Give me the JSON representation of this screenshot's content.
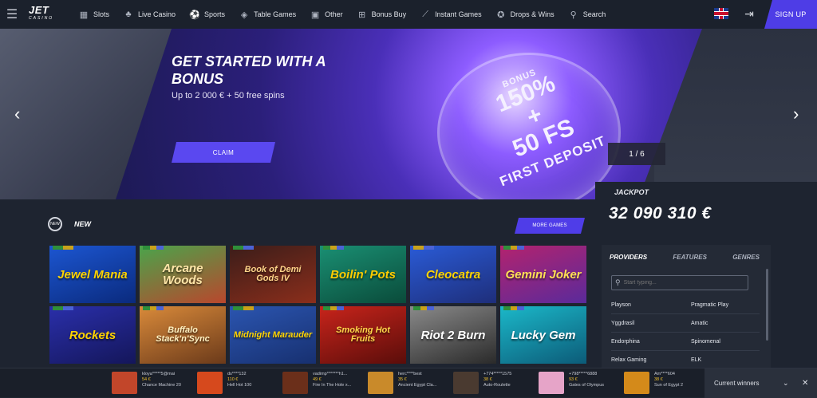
{
  "topbar": {
    "menu_icon": "hamburger-icon",
    "logo_main": "JET",
    "logo_sub": "CASINO",
    "nav": [
      {
        "label": "Slots",
        "icon": "slots-icon"
      },
      {
        "label": "Live Casino",
        "icon": "live-casino-icon"
      },
      {
        "label": "Sports",
        "icon": "sports-icon"
      },
      {
        "label": "Table Games",
        "icon": "table-games-icon"
      },
      {
        "label": "Other",
        "icon": "other-icon"
      },
      {
        "label": "Bonus Buy",
        "icon": "bonus-buy-icon"
      },
      {
        "label": "Instant Games",
        "icon": "instant-games-icon"
      },
      {
        "label": "Drops & Wins",
        "icon": "drops-wins-icon"
      },
      {
        "label": "Search",
        "icon": "search-icon"
      }
    ],
    "signup_label": "SIGN UP"
  },
  "hero": {
    "title": "GET STARTED WITH A BONUS",
    "subtitle": "Up to 2 000 € + 50 free spins",
    "claim_label": "CLAIM",
    "badge_small": "BONUS",
    "badge_line1": "150%",
    "badge_line2": "+",
    "badge_line3": "50 FS",
    "badge_deposit": "FIRST DEPOSIT",
    "slide_counter": "1 / 6",
    "prev_arrow": "‹",
    "next_arrow": "›"
  },
  "jackpot": {
    "label": "JACKPOT",
    "value": "32 090 310 €"
  },
  "new_section": {
    "icon_text": "NEW",
    "label": "NEW",
    "more_label": "MORE GAMES"
  },
  "games": [
    {
      "title": "Jewel Mania",
      "color1": "#1c56d1",
      "color2": "#0a2a7d",
      "text_color": "#ffd400",
      "flags": [
        "#2f8f3a",
        "#c9a21a"
      ]
    },
    {
      "title": "Arcane Woods",
      "color1": "#4aa44b",
      "color2": "#b9472d",
      "text_color": "#ffe6a8",
      "flags": [
        "#2f8f3a",
        "#c9a21a",
        "#4b63d6"
      ]
    },
    {
      "title": "Book of Demi Gods IV",
      "color1": "#3b1d1a",
      "color2": "#8b2e1b",
      "text_color": "#ffd58a",
      "flags": [
        "#2f8f3a",
        "#4b63d6"
      ]
    },
    {
      "title": "Boilin' Pots",
      "color1": "#1a8f73",
      "color2": "#0a4b3a",
      "text_color": "#ffcc00",
      "flags": [
        "#2f8f3a",
        "#c9a21a",
        "#4b63d6"
      ]
    },
    {
      "title": "Cleocatra",
      "color1": "#2a5bd6",
      "color2": "#1e2e7a",
      "text_color": "#ffd400",
      "flags": [
        "#c9a21a",
        "#4b63d6"
      ]
    },
    {
      "title": "Gemini Joker",
      "color1": "#b3236e",
      "color2": "#5a2a9b",
      "text_color": "#ffe055",
      "flags": [
        "#2f8f3a",
        "#c9a21a",
        "#4b63d6"
      ]
    },
    {
      "title": "Rockets",
      "color1": "#2a2faa",
      "color2": "#14165a",
      "text_color": "#ffd400",
      "flags": [
        "#2f8f3a",
        "#4b63d6"
      ]
    },
    {
      "title": "Buffalo Stack'n'Sync",
      "color1": "#d98a3a",
      "color2": "#6b3a1a",
      "text_color": "#fff1c1",
      "flags": [
        "#2f8f3a",
        "#c9a21a",
        "#4b63d6"
      ]
    },
    {
      "title": "Midnight Marauder",
      "color1": "#2b55b0",
      "color2": "#173070",
      "text_color": "#ffd400",
      "flags": [
        "#2f8f3a",
        "#c9a21a"
      ]
    },
    {
      "title": "Smoking Hot Fruits",
      "color1": "#c8241b",
      "color2": "#5a0d0a",
      "text_color": "#ffd84a",
      "flags": [
        "#2f8f3a",
        "#c9a21a",
        "#4b63d6"
      ]
    },
    {
      "title": "Riot 2 Burn",
      "color1": "#8a8a8a",
      "color2": "#2a2a2a",
      "text_color": "#ffffff",
      "flags": [
        "#2f8f3a",
        "#c9a21a",
        "#4b63d6"
      ]
    },
    {
      "title": "Lucky Gem",
      "color1": "#1bb8c9",
      "color2": "#0c5b78",
      "text_color": "#ffffff",
      "flags": [
        "#2f8f3a",
        "#c9a21a",
        "#4b63d6"
      ]
    }
  ],
  "sidebar": {
    "tabs": [
      "PROVIDERS",
      "FEATURES",
      "GENRES"
    ],
    "search_placeholder": "Start typing...",
    "providers": [
      "Playson",
      "Pragmatic Play",
      "Yggdrasil",
      "Amatic",
      "Endorphina",
      "Spinomenal",
      "Relax Gaming",
      "ELK"
    ]
  },
  "winners": {
    "current_label": "Current winners",
    "items": [
      {
        "user": "kloya*****5@mai",
        "amount": "54 €",
        "game": "Chance Machine 20",
        "color": "#c2462a"
      },
      {
        "user": "ds****132",
        "amount": "110 €",
        "game": "Hell Hot 100",
        "color": "#d6491d"
      },
      {
        "user": "vadimp*******h1...",
        "amount": "49 €",
        "game": "Fire In The Hole x...",
        "color": "#6b2f1a"
      },
      {
        "user": "herc****best",
        "amount": "35 €",
        "game": "Ancient Egypt Cla...",
        "color": "#c98a2a"
      },
      {
        "user": "+774*****1575",
        "amount": "38 €",
        "game": "Auto-Roulette",
        "color": "#4a3a30"
      },
      {
        "user": "+798*****6888",
        "amount": "93 €",
        "game": "Gates of Olympus",
        "color": "#e6a4c8"
      },
      {
        "user": "Am****604",
        "amount": "38 €",
        "game": "Sun of Egypt 2",
        "color": "#d48a1a"
      }
    ]
  }
}
